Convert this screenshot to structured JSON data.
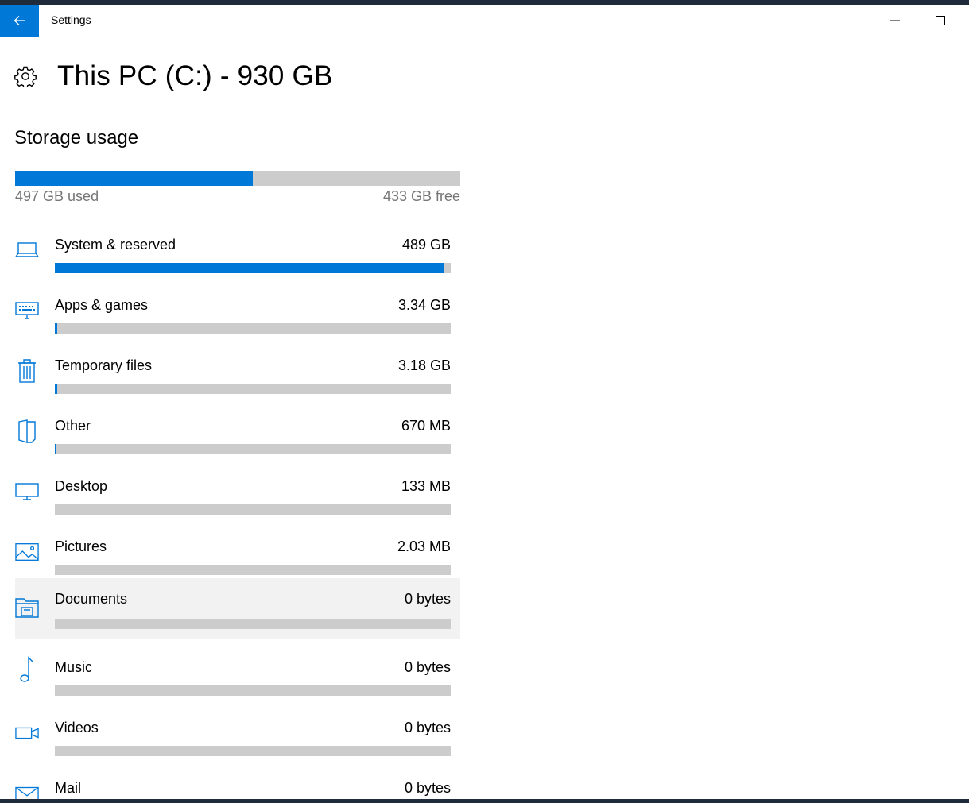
{
  "window": {
    "title": "Settings"
  },
  "page": {
    "title": "This PC (C:) - 930 GB"
  },
  "storage": {
    "section_title": "Storage usage",
    "used_label": "497 GB used",
    "free_label": "433 GB free",
    "used_fraction": 0.534
  },
  "categories": [
    {
      "label": "System & reserved",
      "size": "489 GB",
      "fraction": 0.984,
      "icon": "laptop-icon"
    },
    {
      "label": "Apps & games",
      "size": "3.34 GB",
      "fraction": 0.007,
      "icon": "keyboard-icon"
    },
    {
      "label": "Temporary files",
      "size": "3.18 GB",
      "fraction": 0.007,
      "icon": "trash-icon"
    },
    {
      "label": "Other",
      "size": "670 MB",
      "fraction": 0.002,
      "icon": "other-files-icon"
    },
    {
      "label": "Desktop",
      "size": "133 MB",
      "fraction": 0.0,
      "icon": "monitor-icon"
    },
    {
      "label": "Pictures",
      "size": "2.03 MB",
      "fraction": 0.0,
      "icon": "pictures-icon"
    },
    {
      "label": "Documents",
      "size": "0 bytes",
      "fraction": 0.0,
      "icon": "documents-icon"
    },
    {
      "label": "Music",
      "size": "0 bytes",
      "fraction": 0.0,
      "icon": "music-note-icon"
    },
    {
      "label": "Videos",
      "size": "0 bytes",
      "fraction": 0.0,
      "icon": "video-camera-icon"
    },
    {
      "label": "Mail",
      "size": "0 bytes",
      "fraction": 0.0,
      "icon": "mail-icon"
    }
  ],
  "colors": {
    "accent": "#0078d7",
    "bar_track": "#cccccc",
    "hover_row": "#f2f2f2",
    "secondary_text": "#767676"
  }
}
